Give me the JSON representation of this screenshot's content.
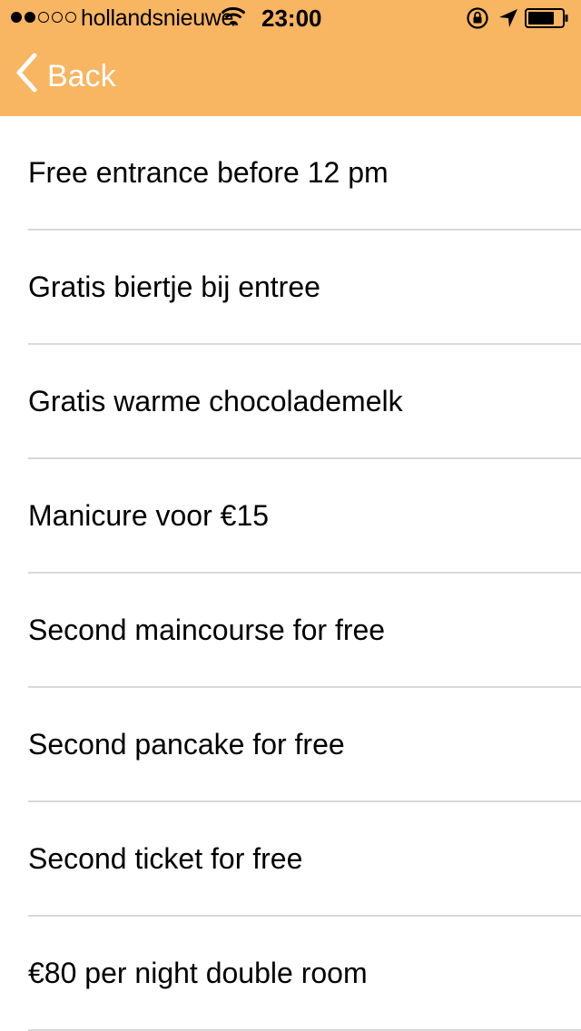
{
  "status_bar": {
    "carrier": "hollandsnieuwe.",
    "time": "23:00",
    "signal_dots_filled": 2,
    "signal_dots_total": 5
  },
  "nav": {
    "back_label": "Back"
  },
  "theme": {
    "header_color": "#f8b562",
    "separator_color": "#d9d9d9"
  },
  "list": {
    "items": [
      {
        "label": "Free entrance before 12 pm"
      },
      {
        "label": "Gratis biertje bij entree"
      },
      {
        "label": "Gratis warme chocolademelk"
      },
      {
        "label": "Manicure voor €15"
      },
      {
        "label": "Second maincourse for free"
      },
      {
        "label": "Second pancake for free"
      },
      {
        "label": "Second ticket for free"
      },
      {
        "label": "€80 per night double room"
      }
    ]
  }
}
